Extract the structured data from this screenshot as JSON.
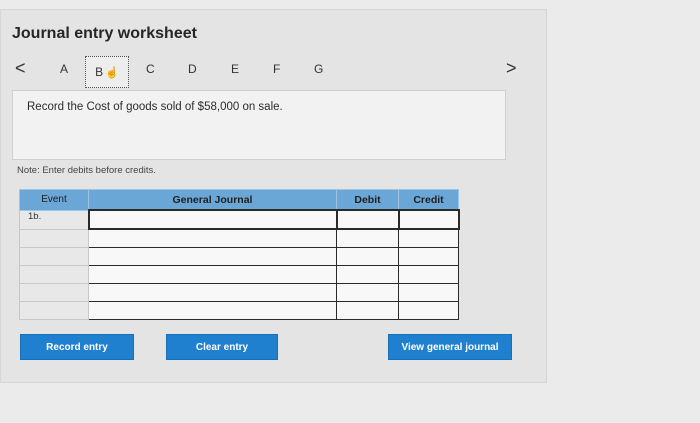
{
  "title": "Journal entry worksheet",
  "nav": {
    "prev": "<",
    "next": ">",
    "tabs": [
      "A",
      "B",
      "C",
      "D",
      "E",
      "F",
      "G"
    ]
  },
  "instruction": "Record the Cost of goods sold of $58,000 on sale.",
  "note": "Note: Enter debits before credits.",
  "table": {
    "headers": {
      "event": "Event",
      "general_journal": "General Journal",
      "debit": "Debit",
      "credit": "Credit"
    },
    "event_value": "1b."
  },
  "buttons": {
    "record": "Record entry",
    "clear": "Clear entry",
    "view": "View general journal"
  },
  "colors": {
    "button_blue": "#1f80d0",
    "header_blue": "#6aa6d6"
  }
}
